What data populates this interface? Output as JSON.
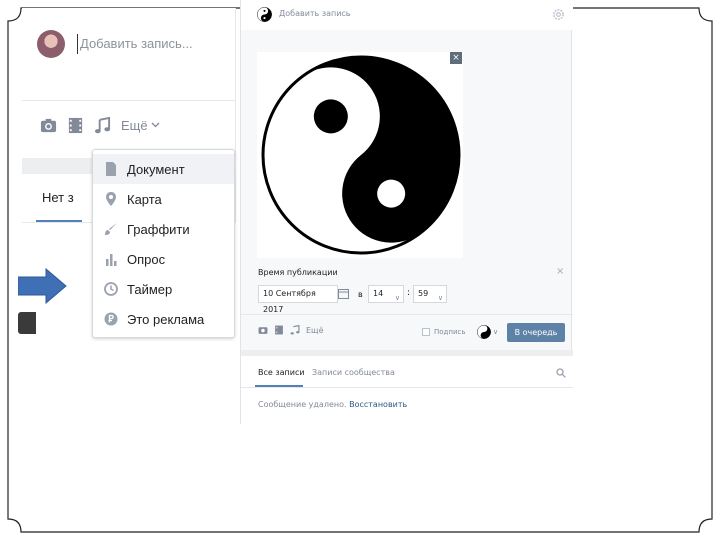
{
  "left_panel": {
    "post_placeholder": "Добавить запись...",
    "more_label": "Ещё",
    "tab_label": "Нет з",
    "dropdown": [
      {
        "label": "Документ",
        "icon": "document-icon",
        "active": true
      },
      {
        "label": "Карта",
        "icon": "map-pin-icon",
        "active": false
      },
      {
        "label": "Граффити",
        "icon": "brush-icon",
        "active": false
      },
      {
        "label": "Опрос",
        "icon": "poll-icon",
        "active": false
      },
      {
        "label": "Таймер",
        "icon": "clock-icon",
        "active": false
      },
      {
        "label": "Это реклама",
        "icon": "ad-icon",
        "active": false
      }
    ]
  },
  "right_panel": {
    "header_text": "Добавить запись",
    "publish_time_label": "Время публикации",
    "date_value": "10 Сентября 2017",
    "in_label": "в",
    "hour_value": "14",
    "colon": ":",
    "minute_value": "59",
    "more_label": "Ещё",
    "sign_label": "Подпись",
    "queue_button": "В очередь",
    "tab_all": "Все записи",
    "tab_community": "Записи сообщества",
    "deleted_text": "Сообщение удалено.",
    "restore_link": "Восстановить",
    "photo_close": "×",
    "pub_close": "×"
  },
  "colors": {
    "accent": "#5181b8",
    "link": "#2a5885",
    "button": "#5e81a8",
    "arrow": "#3f6fb5"
  }
}
